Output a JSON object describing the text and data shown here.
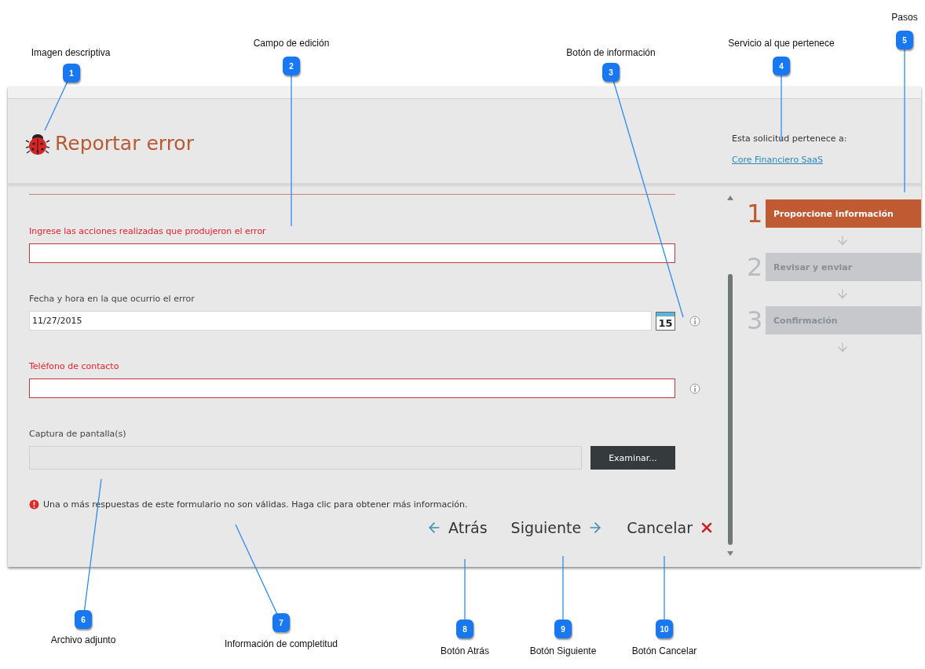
{
  "header": {
    "title": "Reportar error",
    "service_label": "Esta solicitud pertenece a:",
    "service_link": "Core Financiero SaaS"
  },
  "fields": [
    {
      "kind": "text",
      "label": "Ingrese las acciones realizadas que produjeron el error",
      "required": true,
      "info": false
    },
    {
      "kind": "date",
      "label": "Fecha y hora en la que ocurrio el error",
      "required": false,
      "info": true,
      "value": "11/27/2015",
      "calendar_day": "15"
    },
    {
      "kind": "text",
      "label": "Teléfono de contacto",
      "required": true,
      "info": true
    },
    {
      "kind": "file",
      "label": "Captura de pantalla(s)",
      "required": false,
      "info": false,
      "button": "Examinar..."
    }
  ],
  "validation_message": "Una o más respuestas de este formulario no son válidas. Haga clic para obtener más información.",
  "nav": [
    {
      "kind": "back",
      "label": "Atrás"
    },
    {
      "kind": "next",
      "label": "Siguiente"
    },
    {
      "kind": "cancel",
      "label": "Cancelar"
    }
  ],
  "steps": [
    {
      "number": "1",
      "label": "Proporcione información",
      "selected": true
    },
    {
      "number": "2",
      "label": "Revisar y enviar",
      "selected": false
    },
    {
      "number": "3",
      "label": "Confirmación",
      "selected": false
    }
  ],
  "callouts": [
    {
      "number": "1",
      "label": "Imagen descriptiva"
    },
    {
      "number": "2",
      "label": "Campo de edición"
    },
    {
      "number": "3",
      "label": "Botón de información"
    },
    {
      "number": "4",
      "label": "Servicio al que pertenece"
    },
    {
      "number": "5",
      "label": "Pasos"
    },
    {
      "number": "6",
      "label": "Archivo adjunto"
    },
    {
      "number": "7",
      "label": "Información de completitud"
    },
    {
      "number": "8",
      "label": "Botón Atrás"
    },
    {
      "number": "9",
      "label": "Botón Siguiente"
    },
    {
      "number": "10",
      "label": "Botón Cancelar"
    }
  ]
}
